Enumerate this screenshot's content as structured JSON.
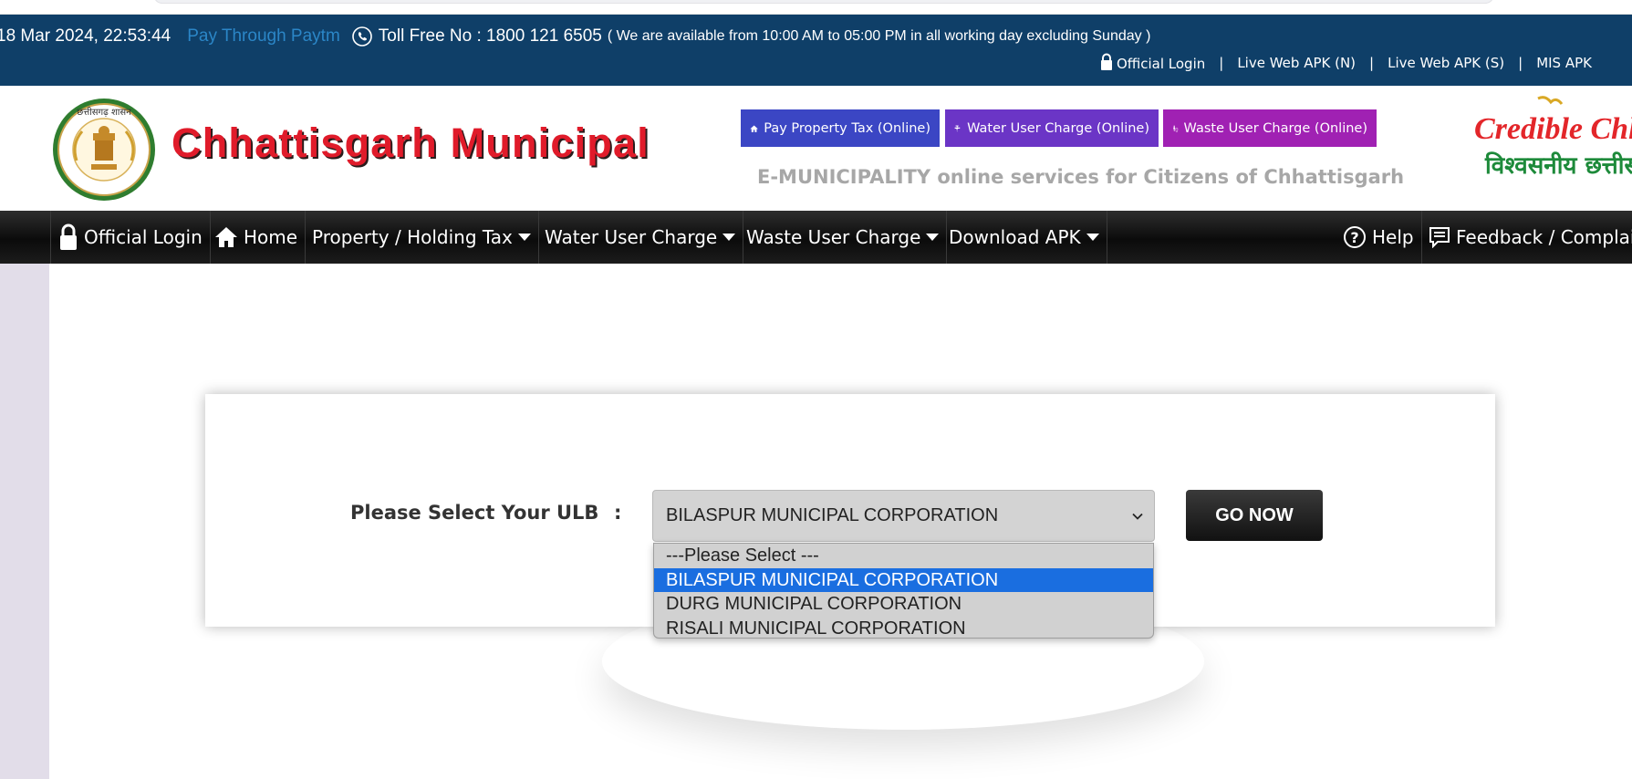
{
  "topbar": {
    "datetime": "18 Mar 2024, 22:53:44",
    "paytm": "Pay Through Paytm",
    "tollfree": "Toll Free No : 1800 121 6505",
    "hours": "( We are available from 10:00 AM to 05:00 PM in all working day excluding Sunday )",
    "links": {
      "official_login": "Official Login",
      "live_apk_n": "Live Web APK (N)",
      "live_apk_s": "Live Web APK (S)",
      "mis_apk": "MIS APK",
      "separator": "|"
    }
  },
  "header": {
    "emblem_text": "छत्तीसगढ़ शासन",
    "title": "Chhattisgarh Municipal",
    "services": {
      "property": "Pay Property Tax (Online)",
      "water": "Water User Charge (Online)",
      "waste": "Waste User Charge (Online)"
    },
    "tagline": "E-MUNICIPALITY online services for Citizens of Chhattisgarh",
    "logo_line1": "Credible Chhattisgarh",
    "logo_line2": "विश्वसनीय छत्तीसगढ़"
  },
  "nav": {
    "official_login": "Official Login",
    "home": "Home",
    "property": "Property / Holding Tax",
    "water": "Water User Charge",
    "waste": "Waste User Charge",
    "apk": "Download APK",
    "help": "Help",
    "feedback": "Feedback / Complai"
  },
  "form": {
    "label": "Please Select Your ULB",
    "colon": ":",
    "selected_value": "BILASPUR MUNICIPAL CORPORATION",
    "options": [
      "---Please Select ---",
      "BILASPUR MUNICIPAL CORPORATION",
      "DURG MUNICIPAL CORPORATION",
      "RISALI MUNICIPAL CORPORATION"
    ],
    "selected_index": 1,
    "go_label": "GO NOW"
  },
  "colors": {
    "topbar_bg": "#0f3f68",
    "title_red": "#e01b2a",
    "btn_property": "#3b46c4",
    "btn_water": "#6b35c6",
    "btn_waste": "#a021b3",
    "option_highlight": "#1a6ee0"
  },
  "icons": {
    "phone": "phone-icon",
    "lock": "lock-icon",
    "home": "home-icon",
    "tap": "water-tap-icon",
    "bin": "waste-bin-icon",
    "help": "help-icon",
    "feedback": "feedback-icon",
    "caret": "caret-down-icon",
    "chevron": "chevron-down-icon"
  }
}
